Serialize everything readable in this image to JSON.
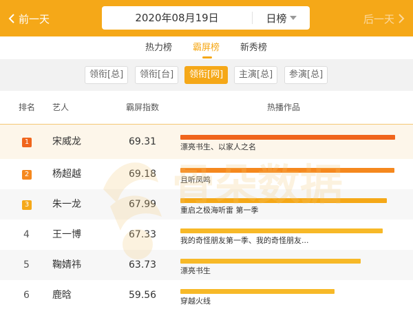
{
  "header": {
    "prev_label": "前一天",
    "next_label": "后一天",
    "date": "2020年08月19日",
    "period": "日榜",
    "accent_color": "#f5a818"
  },
  "tabs": [
    {
      "label": "热力榜",
      "active": false
    },
    {
      "label": "霸屏榜",
      "active": true
    },
    {
      "label": "新秀榜",
      "active": false
    }
  ],
  "filters": [
    {
      "label": "领衔[总]",
      "active": false
    },
    {
      "label": "领衔[台]",
      "active": false
    },
    {
      "label": "领衔[网]",
      "active": true
    },
    {
      "label": "主演[总]",
      "active": false
    },
    {
      "label": "参演[总]",
      "active": false
    }
  ],
  "table": {
    "columns": [
      "排名",
      "艺人",
      "霸屏指数",
      "热播作品"
    ],
    "rows": [
      {
        "rank": "1",
        "artist": "宋威龙",
        "score": "69.31",
        "works": "漂亮书生、以家人之名",
        "bar_value": 69.31,
        "bar_color": "#f0651c"
      },
      {
        "rank": "2",
        "artist": "杨超越",
        "score": "69.18",
        "works": "且听凤鸣",
        "bar_value": 69.18,
        "bar_color": "#f5881e"
      },
      {
        "rank": "3",
        "artist": "朱一龙",
        "score": "67.99",
        "works": "重启之极海听雷 第一季",
        "bar_value": 67.99,
        "bar_color": "#f5a818"
      },
      {
        "rank": "4",
        "artist": "王一博",
        "score": "67.33",
        "works": "我的奇怪朋友第一季、我的奇怪朋友...",
        "bar_value": 67.33,
        "bar_color": "#f7b928"
      },
      {
        "rank": "5",
        "artist": "鞠婧祎",
        "score": "63.73",
        "works": "漂亮书生",
        "bar_value": 63.73,
        "bar_color": "#f7b928"
      },
      {
        "rank": "6",
        "artist": "鹿晗",
        "score": "59.56",
        "works": "穿越火线",
        "bar_value": 59.56,
        "bar_color": "#f7b928"
      }
    ]
  },
  "watermark": {
    "text": "骨朵数据"
  }
}
